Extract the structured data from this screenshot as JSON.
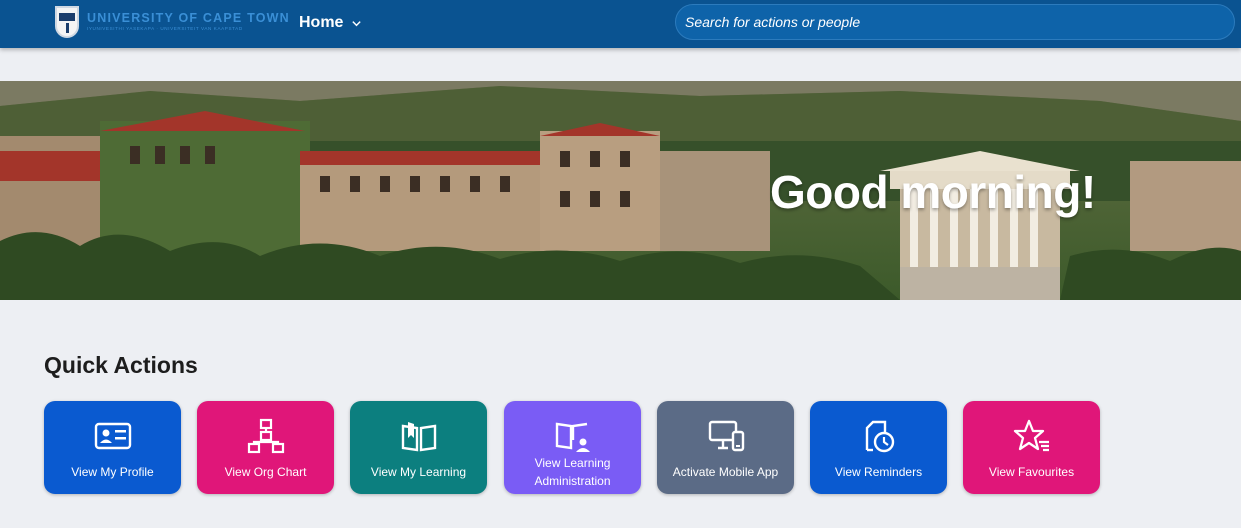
{
  "header": {
    "logo_title": "UNIVERSITY OF CAPE TOWN",
    "logo_subtitle": "IYUNIVESITHI YASEKAPA · UNIVERSITEIT VAN KAAPSTAD",
    "home_label": "Home",
    "search_placeholder": "Search for actions or people"
  },
  "banner": {
    "greeting": "Good morning!"
  },
  "quick_actions": {
    "title": "Quick Actions",
    "tiles": [
      {
        "label": "View My Profile",
        "icon": "profile-card-icon",
        "color": "#0a5ad0"
      },
      {
        "label": "View Org Chart",
        "icon": "org-chart-icon",
        "color": "#e01679"
      },
      {
        "label": "View My Learning",
        "icon": "learning-book-icon",
        "color": "#0c7f7f"
      },
      {
        "label": "View Learning Administration",
        "icon": "learning-admin-icon",
        "color": "#7a5cf5"
      },
      {
        "label": "Activate Mobile App",
        "icon": "mobile-device-icon",
        "color": "#5b6b86"
      },
      {
        "label": "View Reminders",
        "icon": "reminder-clock-icon",
        "color": "#0a5ad0"
      },
      {
        "label": "View Favourites",
        "icon": "favourite-star-icon",
        "color": "#e01679"
      }
    ]
  }
}
